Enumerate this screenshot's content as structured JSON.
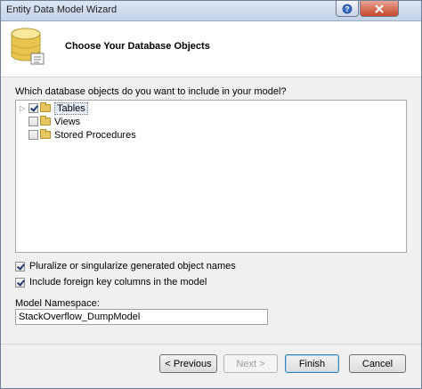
{
  "window": {
    "title": "Entity Data Model Wizard"
  },
  "header": {
    "title": "Choose Your Database Objects",
    "icon": "database-icon"
  },
  "prompt": "Which database objects do you want to include in your model?",
  "tree": {
    "items": [
      {
        "label": "Tables",
        "checked": true,
        "selected": true
      },
      {
        "label": "Views",
        "checked": false
      },
      {
        "label": "Stored Procedures",
        "checked": false
      }
    ]
  },
  "options": {
    "pluralize": {
      "label": "Pluralize or singularize generated object names",
      "checked": true
    },
    "foreign_keys": {
      "label": "Include foreign key columns in the model",
      "checked": true
    }
  },
  "namespace": {
    "label": "Model Namespace:",
    "value": "StackOverflow_DumpModel"
  },
  "buttons": {
    "previous": "< Previous",
    "next": "Next >",
    "finish": "Finish",
    "cancel": "Cancel"
  },
  "colors": {
    "title_bar": "#c4d3e6",
    "close_button": "#c8452b",
    "dialog_bg": "#f0f0f0"
  }
}
